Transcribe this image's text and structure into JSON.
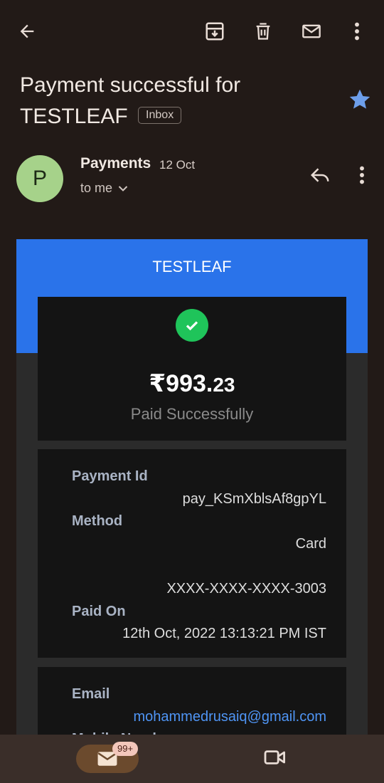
{
  "email": {
    "subject": "Payment successful for TESTLEAF",
    "label": "Inbox",
    "sender_initial": "P",
    "sender": "Payments",
    "date": "12 Oct",
    "recipient": "to me"
  },
  "receipt": {
    "brand": "TESTLEAF",
    "amount_main": "₹993.",
    "amount_decimal": "23",
    "status": "Paid Successfully",
    "payment_id_label": "Payment Id",
    "payment_id": "pay_KSmXblsAf8gpYL",
    "method_label": "Method",
    "method": "Card",
    "card_number": "XXXX-XXXX-XXXX-3003",
    "paid_on_label": "Paid On",
    "paid_on": "12th Oct, 2022 13:13:21 PM IST",
    "email_label": "Email",
    "email": "mohammedrusaiq@gmail.com",
    "mobile_label": "Mobile Number"
  },
  "nav": {
    "mail_count": "99+"
  },
  "colors": {
    "background": "#221a17",
    "brand_blue": "#2a73ea",
    "success_green": "#1fc45a",
    "star": "#6d9eea",
    "avatar": "#a6d28a",
    "link": "#4f95f5"
  },
  "icons": [
    "back-arrow-icon",
    "archive-icon",
    "delete-icon",
    "mark-unread-icon",
    "more-vert-icon",
    "star-icon",
    "reply-icon",
    "chevron-down-icon",
    "check-icon",
    "mail-icon",
    "video-icon"
  ]
}
